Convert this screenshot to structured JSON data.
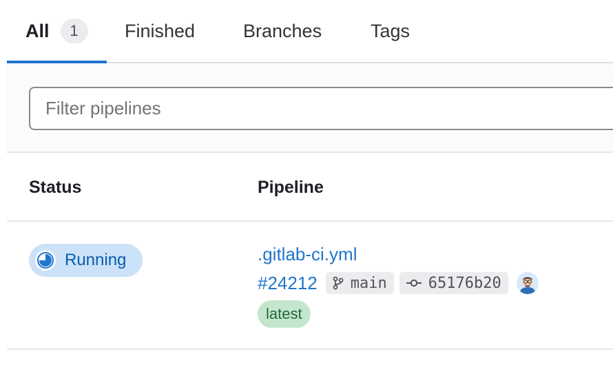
{
  "tabs": [
    {
      "label": "All",
      "count": "1",
      "active": true
    },
    {
      "label": "Finished"
    },
    {
      "label": "Branches"
    },
    {
      "label": "Tags"
    }
  ],
  "filter": {
    "placeholder": "Filter pipelines",
    "value": ""
  },
  "table": {
    "headers": {
      "status": "Status",
      "pipeline": "Pipeline"
    },
    "rows": [
      {
        "status": "Running",
        "status_icon": "status-running-icon",
        "pipeline_name": ".gitlab-ci.yml",
        "pipeline_id": "#24212",
        "branch": "main",
        "branch_icon": "branch-icon",
        "commit": "65176b20",
        "commit_icon": "commit-icon",
        "avatar_icon": "user-avatar",
        "badge": "latest"
      }
    ]
  },
  "colors": {
    "accent": "#1f75cb",
    "running_bg": "#cbe2f9",
    "running_text": "#0b5cad",
    "latest_bg": "#c3e6cd",
    "latest_text": "#24663b"
  }
}
